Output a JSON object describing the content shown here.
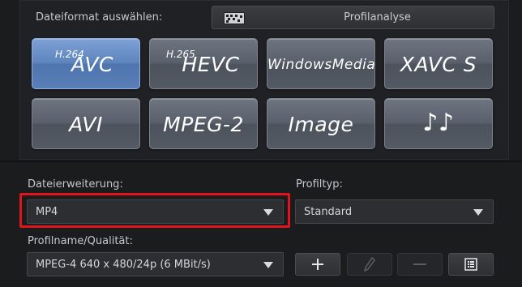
{
  "format_section": {
    "label": "Dateiformat auswählen:",
    "profile_analysis_label": "Profilanalyse",
    "formats": [
      {
        "prefix": "H.264",
        "label": "AVC",
        "selected": true
      },
      {
        "prefix": "H.265",
        "label": "HEVC",
        "selected": false
      },
      {
        "prefix": "",
        "label": "WindowsMedia",
        "selected": false
      },
      {
        "prefix": "",
        "label": "XAVC S",
        "selected": false
      },
      {
        "prefix": "",
        "label": "AVI",
        "selected": false
      },
      {
        "prefix": "",
        "label": "MPEG-2",
        "selected": false
      },
      {
        "prefix": "",
        "label": "Image",
        "selected": false
      },
      {
        "prefix": "",
        "label": "♪♪",
        "selected": false
      }
    ]
  },
  "settings": {
    "extension_label": "Dateierweiterung:",
    "extension_value": "MP4",
    "profile_type_label": "Profiltyp:",
    "profile_type_value": "Standard",
    "profile_name_label": "Profilname/Qualität:",
    "profile_name_value": "MPEG-4 640 x 480/24p (6 MBit/s)"
  },
  "actions": [
    {
      "name": "add",
      "icon": "plus-icon",
      "enabled": true
    },
    {
      "name": "edit",
      "icon": "pencil-icon",
      "enabled": false
    },
    {
      "name": "remove",
      "icon": "minus-icon",
      "enabled": false
    },
    {
      "name": "details",
      "icon": "list-icon",
      "enabled": true
    }
  ],
  "colors": {
    "selected_format": "#5e84bd",
    "format_button": "#5a606b",
    "highlight_border": "#e0141a"
  }
}
